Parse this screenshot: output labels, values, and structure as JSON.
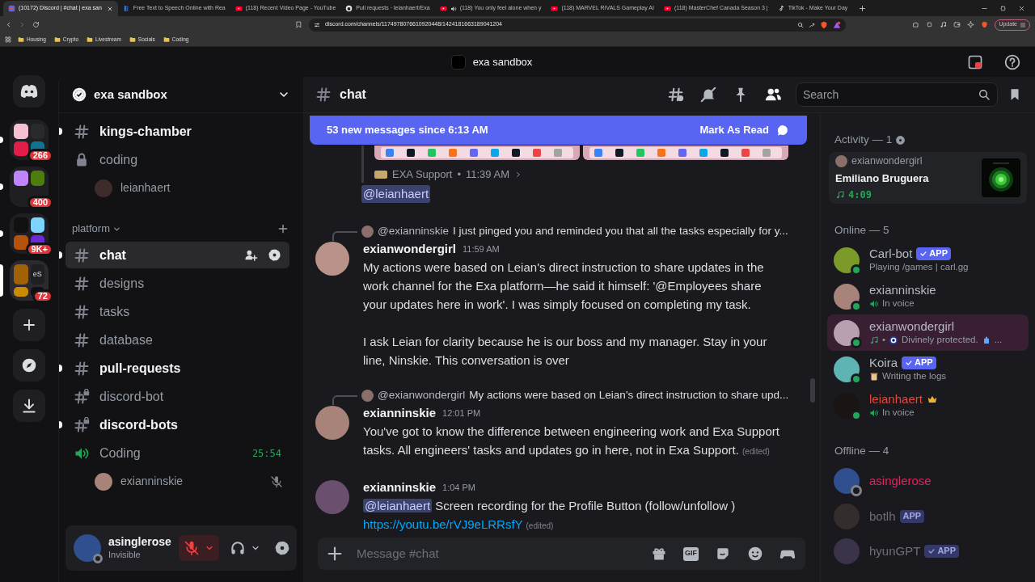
{
  "browser": {
    "tabs": [
      {
        "title": "(10172) Discord | #chat | exa san",
        "kind": "discord",
        "audio": false,
        "selected": true
      },
      {
        "title": "Free Text to Speech Online with Rea",
        "kind": "tts",
        "audio": false,
        "selected": false
      },
      {
        "title": "(118) Recent Video Page - YouTube",
        "kind": "youtube",
        "audio": false,
        "selected": false
      },
      {
        "title": "Pull requests · leianhaert/Exa",
        "kind": "github",
        "audio": false,
        "selected": false
      },
      {
        "title": "(118) You only feel alone when y",
        "kind": "youtube",
        "audio": true,
        "selected": false
      },
      {
        "title": "(118) MARVEL RIVALS Gameplay AI",
        "kind": "youtube",
        "audio": false,
        "selected": false
      },
      {
        "title": "(118) MasterChef Canada Season 3 |",
        "kind": "youtube",
        "audio": false,
        "selected": false
      },
      {
        "title": "TikTok - Make Your Day",
        "kind": "tiktok",
        "audio": false,
        "selected": false
      }
    ],
    "address": "discord.com/channels/1174978076610920448/1424181663189041204",
    "bookmarks": [
      "Housing",
      "Crypto",
      "Livestream",
      "Socials",
      "Coding"
    ],
    "update_label": "Update"
  },
  "app": {
    "title": "exa sandbox"
  },
  "servers": [
    {
      "badge": "266",
      "selected": false
    },
    {
      "badge": "400",
      "selected": false
    },
    {
      "badge": "9K+",
      "selected": false
    },
    {
      "badge": "72",
      "label": "eS",
      "selected": true
    }
  ],
  "sidebar": {
    "server_name": "exa sandbox",
    "channels": [
      {
        "kind": "text",
        "name": "kings-chamber",
        "unread": true,
        "selected": false
      },
      {
        "kind": "voice-locked",
        "name": "coding",
        "unread": false,
        "selected": false,
        "members": [
          {
            "name": "leianhaert",
            "muted": false
          }
        ]
      },
      {
        "kind": "category",
        "name": "platform",
        "expanded": true,
        "children": [
          {
            "kind": "text",
            "name": "chat",
            "unread": true,
            "selected": true
          },
          {
            "kind": "text",
            "name": "designs",
            "unread": false,
            "selected": false
          },
          {
            "kind": "text",
            "name": "tasks",
            "unread": false,
            "selected": false
          },
          {
            "kind": "text",
            "name": "database",
            "unread": false,
            "selected": false
          },
          {
            "kind": "text",
            "name": "pull-requests",
            "unread": true,
            "selected": false
          },
          {
            "kind": "text-locked",
            "name": "discord-bot",
            "unread": false,
            "selected": false
          },
          {
            "kind": "text-locked",
            "name": "discord-bots",
            "unread": true,
            "selected": false
          },
          {
            "kind": "voice",
            "name": "Coding",
            "unread": false,
            "selected": false,
            "active": true,
            "timer": "25:54",
            "members": [
              {
                "name": "exianninskie",
                "muted": true
              }
            ]
          }
        ]
      }
    ]
  },
  "user_panel": {
    "name": "asinglerose",
    "status": "Invisible",
    "mic_muted": true
  },
  "chat": {
    "channel": "chat",
    "search": {
      "placeholder": "Search"
    },
    "banner": {
      "text": "53 new messages since 6:13 AM",
      "action": "Mark As Read"
    },
    "messages": [
      {
        "kind": "forward-tail",
        "source": "EXA Support",
        "separator": "•",
        "time": "11:39 AM",
        "mention": "@leianhaert"
      },
      {
        "kind": "message",
        "author": "exianwondergirl",
        "time": "11:59 AM",
        "reply": {
          "author": "@exianninskie",
          "text": "I just pinged you and reminded you that all the tasks especially for y..."
        },
        "blocks": [
          {
            "kind": "text",
            "text": "My actions were based on Leian's direct instruction to share updates in the work channel for the Exa platform—he said it himself: '@Employees share your updates here in work'. I was simply focused on completing my task."
          },
          {
            "kind": "text",
            "text": "I ask Leian for clarity because he is our boss and my manager. Stay in your line, Ninskie. This conversation is over"
          }
        ]
      },
      {
        "kind": "message",
        "author": "exianninskie",
        "time": "12:01 PM",
        "reply": {
          "author": "@exianwondergirl",
          "text": "My actions were based on Leian's direct instruction to share upd..."
        },
        "edited": "(edited)",
        "blocks": [
          {
            "kind": "text",
            "text": "You've got to know the difference between engineering work and Exa Support tasks. All engineers' tasks and updates go in here, not in Exa Support."
          }
        ]
      },
      {
        "kind": "message",
        "author": "exianninskie",
        "time": "1:04 PM",
        "edited": "(edited)",
        "blocks": [
          {
            "kind": "text",
            "mention": "@leianhaert",
            "text": "Screen recording for the Profile Button (follow/unfollow )"
          },
          {
            "kind": "link",
            "text": "https://youtu.be/rVJ9eLRRsfY"
          }
        ]
      }
    ],
    "composer": {
      "placeholder": "Message #chat",
      "gif_label": "GIF"
    }
  },
  "members": {
    "activity": {
      "header": "Activity — 1",
      "user": "exianwondergirl",
      "title": "Emiliano Bruguera",
      "elapsed": "4:09"
    },
    "groups": [
      {
        "header": "Online — 5",
        "members": [
          {
            "kind": "online",
            "name": "Carl-bot",
            "color": "#b5bac1",
            "highlighted": false,
            "crown": false,
            "badge": {
              "label": "APP",
              "verified": true
            },
            "status": [
              {
                "kind": "text",
                "text": "Playing /games | carl.gg"
              }
            ]
          },
          {
            "kind": "online",
            "name": "exianninskie",
            "color": "#b5bac1",
            "highlighted": false,
            "crown": false,
            "status": [
              {
                "kind": "speaker"
              },
              {
                "kind": "text",
                "text": "In voice"
              }
            ]
          },
          {
            "kind": "online",
            "name": "exianwondergirl",
            "color": "#b5bac1",
            "highlighted": true,
            "crown": false,
            "status": [
              {
                "kind": "music"
              },
              {
                "kind": "text",
                "text": "•"
              },
              {
                "kind": "eye"
              },
              {
                "kind": "text",
                "text": "Divinely protected."
              },
              {
                "kind": "charm"
              },
              {
                "kind": "text",
                "text": "..."
              }
            ]
          },
          {
            "kind": "online",
            "name": "Koira",
            "color": "#b5bac1",
            "highlighted": false,
            "crown": false,
            "badge": {
              "label": "APP",
              "verified": true
            },
            "status": [
              {
                "kind": "scroll"
              },
              {
                "kind": "text",
                "text": "Writing the logs"
              }
            ]
          },
          {
            "kind": "online",
            "name": "leianhaert",
            "color": "#e2483d",
            "highlighted": false,
            "crown": true,
            "status": [
              {
                "kind": "speaker"
              },
              {
                "kind": "text",
                "text": "In voice"
              }
            ]
          }
        ]
      },
      {
        "header": "Offline — 4",
        "members": [
          {
            "kind": "invisible",
            "name": "asinglerose",
            "color": "#e0245e",
            "highlighted": false,
            "crown": false
          },
          {
            "kind": "offline",
            "name": "botlh",
            "color": "#6d6f78",
            "highlighted": false,
            "crown": false,
            "badge": {
              "label": "APP",
              "verified": false
            }
          },
          {
            "kind": "offline",
            "name": "hyunGPT",
            "color": "#6d6f78",
            "highlighted": false,
            "crown": false,
            "badge": {
              "label": "APP",
              "verified": true
            }
          }
        ]
      }
    ]
  }
}
